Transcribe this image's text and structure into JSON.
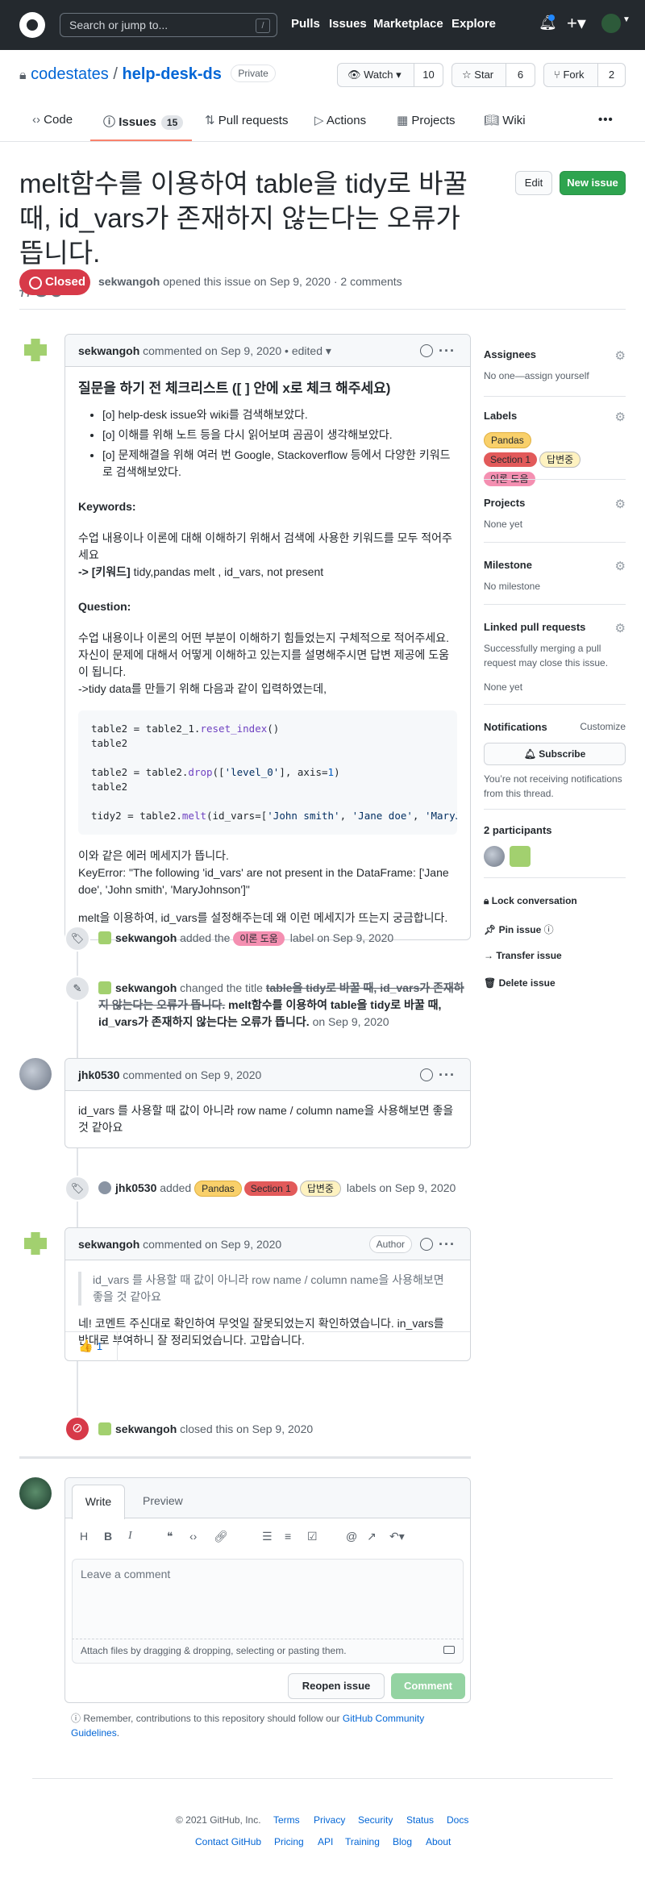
{
  "header": {
    "search_placeholder": "Search or jump to...",
    "search_key": "/",
    "nav": [
      "Pulls",
      "Issues",
      "Marketplace",
      "Explore"
    ]
  },
  "repo": {
    "owner": "codestates",
    "sep": "/",
    "name": "help-desk-ds",
    "visibility": "Private",
    "watch_label": "Watch",
    "watch_count": "10",
    "star_label": "Star",
    "star_count": "6",
    "fork_label": "Fork",
    "fork_count": "2"
  },
  "tabs": {
    "code": "Code",
    "issues": "Issues",
    "issues_count": "15",
    "pulls": "Pull requests",
    "actions": "Actions",
    "projects": "Projects",
    "wiki": "Wiki"
  },
  "issue": {
    "title": "melt함수를 이용하여 table을 tidy로 바꿀 때, id_vars가 존재하지 않는다는 오류가 뜹니다.",
    "number": "#50",
    "edit_label": "Edit",
    "new_issue_label": "New issue",
    "status": "Closed",
    "author": "sekwangoh",
    "meta": "opened this issue on Sep 9, 2020 · 2 comments"
  },
  "comment1": {
    "author": "sekwangoh",
    "meta": "commented on Sep 9, 2020",
    "edited": "• edited ▾",
    "heading": "질문을 하기 전 체크리스트 ([ ] 안에 x로 체크 해주세요)",
    "checklist": [
      "[o] help-desk issue와 wiki를 검색해보았다.",
      "[o] 이해를 위해 노트 등을 다시 읽어보며 곰곰이 생각해보았다.",
      "[o] 문제해결을 위해 여러 번 Google, Stackoverflow 등에서 다양한 키워드로 검색해보았다."
    ],
    "keywords_label": "Keywords:",
    "keywords_desc": "수업 내용이나 이론에 대해 이해하기 위해서 검색에 사용한 키워드를 모두 적어주세요",
    "keywords_prefix": "-> [키워드]",
    "keywords_value": " tidy,pandas melt , id_vars, not present",
    "question_label": "Question:",
    "question_desc": "수업 내용이나 이론의 어떤 부분이 이해하기 힘들었는지 구체적으로 적어주세요. 자신이 문제에 대해서 어떻게 이해하고 있는지를 설명해주시면 답변 제공에 도움이 됩니다.",
    "question_text": "->tidy data를 만들기 위해 다음과 같이 입력하였는데,",
    "error_intro": "이와 같은 에러 메세지가 뜹니다.",
    "error_text": "KeyError: \"The following 'id_vars' are not present in the DataFrame: ['Jane doe', 'John smith', 'MaryJohnson']\"",
    "closing": "melt을 이용하여, id_vars를 설정해주는데 왜 이런 메세지가 뜨는지 궁금합니다."
  },
  "event_label": {
    "author": "sekwangoh",
    "pre": "added the",
    "label": "이론 도움",
    "post": "label on Sep 9, 2020"
  },
  "event_title": {
    "author": "sekwangoh",
    "pre": "changed the title",
    "old": "table을 tidy로 바꿀 때, id_vars가 존재하지 않는다는 오류가 뜹니다.",
    "new": "melt함수를 이용하여 table을 tidy로 바꿀 때, id_vars가 존재하지 않는다는 오류가 뜹니다.",
    "post": "on Sep 9, 2020"
  },
  "comment2": {
    "author": "jhk0530",
    "meta": "commented on Sep 9, 2020",
    "text": "id_vars 를 사용할 때 값이 아니라 row name / column name을 사용해보면 좋을 것 같아요"
  },
  "event_labels": {
    "author": "jhk0530",
    "pre": "added",
    "labels": [
      "Pandas",
      "Section 1",
      "답변중"
    ],
    "post": "labels on Sep 9, 2020"
  },
  "comment3": {
    "author": "sekwangoh",
    "meta": "commented on Sep 9, 2020",
    "role": "Author",
    "quote": "id_vars 를 사용할 때 값이 아니라 row name / column name을 사용해보면 좋을 것 같아요",
    "text": "네! 코멘트 주신대로 확인하여 무엇일 잘못되었는지 확인하였습니다. in_vars를 반대로 부여하니 잘 정리되었습니다. 고맙습니다.",
    "reaction": "👍",
    "reaction_count": "1"
  },
  "event_closed": {
    "author": "sekwangoh",
    "text": "closed this on Sep 9, 2020"
  },
  "sidebar": {
    "assignees_label": "Assignees",
    "assignees_value": "No one—assign yourself",
    "labels_label": "Labels",
    "labels": [
      {
        "name": "Pandas",
        "color": "#f9d06a"
      },
      {
        "name": "Section 1",
        "color": "#e25a5a"
      },
      {
        "name": "답변중",
        "color": "#fef2c0"
      },
      {
        "name": "이론 도움",
        "color": "#f48fb1"
      }
    ],
    "projects_label": "Projects",
    "projects_value": "None yet",
    "milestone_label": "Milestone",
    "milestone_value": "No milestone",
    "linked_label": "Linked pull requests",
    "linked_desc": "Successfully merging a pull request may close this issue.",
    "linked_value": "None yet",
    "notifications_label": "Notifications",
    "customize": "Customize",
    "subscribe": "Subscribe",
    "notif_desc": "You’re not receiving notifications from this thread.",
    "participants": "2 participants",
    "lock": "Lock conversation",
    "pin": "Pin issue",
    "transfer": "Transfer issue",
    "delete": "Delete issue"
  },
  "editor": {
    "write": "Write",
    "preview": "Preview",
    "placeholder": "Leave a comment",
    "attach": "Attach files by dragging & dropping, selecting or pasting them.",
    "reopen": "Reopen issue",
    "comment": "Comment",
    "note_pre": "Remember, contributions to this repository should follow our",
    "note_link": "GitHub Community Guidelines",
    "note_post": "."
  },
  "footer": {
    "copyright": "© 2021 GitHub, Inc.",
    "row1": [
      "Terms",
      "Privacy",
      "Security",
      "Status",
      "Docs"
    ],
    "row2": [
      "Contact GitHub",
      "Pricing",
      "API",
      "Training",
      "Blog",
      "About"
    ]
  },
  "colors": {
    "closed": "#d73a49",
    "green_button": "#2ea44f",
    "link": "#0366d6"
  }
}
